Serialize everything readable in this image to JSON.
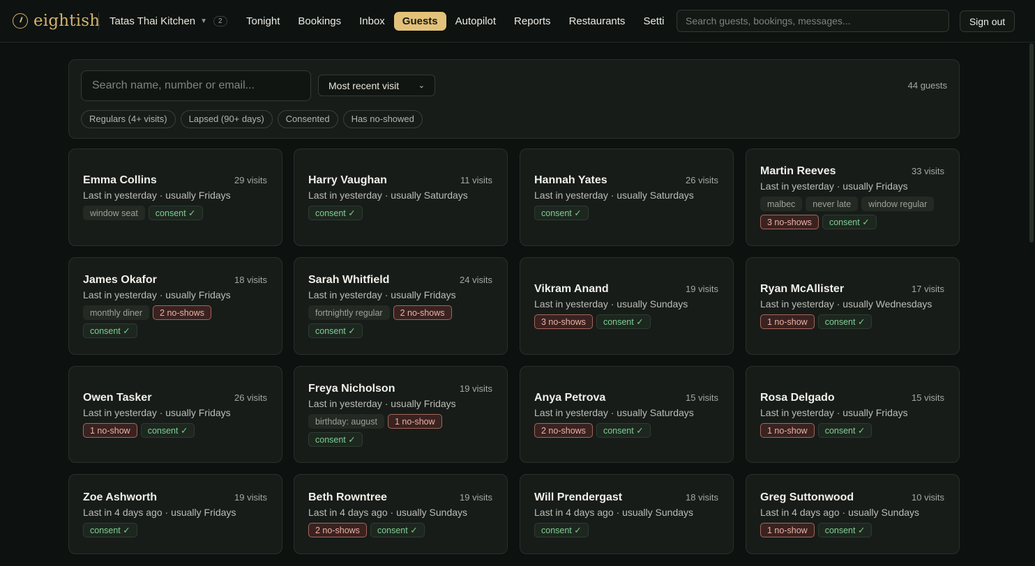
{
  "app": {
    "brand": "eightish",
    "restaurant": "Tatas Thai Kitchen",
    "restaurant_count": "2"
  },
  "nav": {
    "items": [
      "Tonight",
      "Bookings",
      "Inbox",
      "Guests",
      "Autopilot",
      "Reports",
      "Restaurants",
      "Setti"
    ],
    "active": "Guests"
  },
  "header": {
    "search_placeholder": "Search guests, bookings, messages...",
    "sign_out": "Sign out"
  },
  "filters": {
    "search_placeholder": "Search name, number or email...",
    "sort_value": "Most recent visit",
    "guest_count": "44 guests",
    "chips": [
      "Regulars (4+ visits)",
      "Lapsed (90+ days)",
      "Consented",
      "Has no-showed"
    ]
  },
  "colors": {
    "accent": "#e2c27a",
    "background": "#0d110f",
    "card": "#171c19",
    "consent": "#7fcf94",
    "no_show": "#eab1a5"
  },
  "guests": [
    {
      "name": "Emma Collins",
      "visits": "29 visits",
      "last_in": "Last in yesterday · usually Fridays",
      "tags": [
        {
          "text": "window seat",
          "kind": "note"
        },
        {
          "text": "consent ✓",
          "kind": "consent"
        }
      ]
    },
    {
      "name": "Harry Vaughan",
      "visits": "11 visits",
      "last_in": "Last in yesterday · usually Saturdays",
      "tags": [
        {
          "text": "consent ✓",
          "kind": "consent"
        }
      ]
    },
    {
      "name": "Hannah Yates",
      "visits": "26 visits",
      "last_in": "Last in yesterday · usually Saturdays",
      "tags": [
        {
          "text": "consent ✓",
          "kind": "consent"
        }
      ]
    },
    {
      "name": "Martin Reeves",
      "visits": "33 visits",
      "last_in": "Last in yesterday · usually Fridays",
      "tags": [
        {
          "text": "malbec",
          "kind": "note"
        },
        {
          "text": "never late",
          "kind": "note"
        },
        {
          "text": "window regular",
          "kind": "note"
        },
        {
          "text": "3 no-shows",
          "kind": "noshow"
        },
        {
          "text": "consent ✓",
          "kind": "consent"
        }
      ]
    },
    {
      "name": "James Okafor",
      "visits": "18 visits",
      "last_in": "Last in yesterday · usually Fridays",
      "tags": [
        {
          "text": "monthly diner",
          "kind": "note"
        },
        {
          "text": "2 no-shows",
          "kind": "noshow"
        },
        {
          "text": "consent ✓",
          "kind": "consent"
        }
      ]
    },
    {
      "name": "Sarah Whitfield",
      "visits": "24 visits",
      "last_in": "Last in yesterday · usually Fridays",
      "tags": [
        {
          "text": "fortnightly regular",
          "kind": "note"
        },
        {
          "text": "2 no-shows",
          "kind": "noshow"
        },
        {
          "text": "consent ✓",
          "kind": "consent"
        }
      ]
    },
    {
      "name": "Vikram Anand",
      "visits": "19 visits",
      "last_in": "Last in yesterday · usually Sundays",
      "tags": [
        {
          "text": "3 no-shows",
          "kind": "noshow"
        },
        {
          "text": "consent ✓",
          "kind": "consent"
        }
      ]
    },
    {
      "name": "Ryan McAllister",
      "visits": "17 visits",
      "last_in": "Last in yesterday · usually Wednesdays",
      "tags": [
        {
          "text": "1 no-show",
          "kind": "noshow"
        },
        {
          "text": "consent ✓",
          "kind": "consent"
        }
      ]
    },
    {
      "name": "Owen Tasker",
      "visits": "26 visits",
      "last_in": "Last in yesterday · usually Fridays",
      "tags": [
        {
          "text": "1 no-show",
          "kind": "noshow"
        },
        {
          "text": "consent ✓",
          "kind": "consent"
        }
      ]
    },
    {
      "name": "Freya Nicholson",
      "visits": "19 visits",
      "last_in": "Last in yesterday · usually Fridays",
      "tags": [
        {
          "text": "birthday: august",
          "kind": "note"
        },
        {
          "text": "1 no-show",
          "kind": "noshow"
        },
        {
          "text": "consent ✓",
          "kind": "consent"
        }
      ]
    },
    {
      "name": "Anya Petrova",
      "visits": "15 visits",
      "last_in": "Last in yesterday · usually Saturdays",
      "tags": [
        {
          "text": "2 no-shows",
          "kind": "noshow"
        },
        {
          "text": "consent ✓",
          "kind": "consent"
        }
      ]
    },
    {
      "name": "Rosa Delgado",
      "visits": "15 visits",
      "last_in": "Last in yesterday · usually Fridays",
      "tags": [
        {
          "text": "1 no-show",
          "kind": "noshow"
        },
        {
          "text": "consent ✓",
          "kind": "consent"
        }
      ]
    },
    {
      "name": "Zoe Ashworth",
      "visits": "19 visits",
      "last_in": "Last in 4 days ago · usually Fridays",
      "tags": [
        {
          "text": "consent ✓",
          "kind": "consent"
        }
      ]
    },
    {
      "name": "Beth Rowntree",
      "visits": "19 visits",
      "last_in": "Last in 4 days ago · usually Sundays",
      "tags": [
        {
          "text": "2 no-shows",
          "kind": "noshow"
        },
        {
          "text": "consent ✓",
          "kind": "consent"
        }
      ]
    },
    {
      "name": "Will Prendergast",
      "visits": "18 visits",
      "last_in": "Last in 4 days ago · usually Sundays",
      "tags": [
        {
          "text": "consent ✓",
          "kind": "consent"
        }
      ]
    },
    {
      "name": "Greg Suttonwood",
      "visits": "10 visits",
      "last_in": "Last in 4 days ago · usually Sundays",
      "tags": [
        {
          "text": "1 no-show",
          "kind": "noshow"
        },
        {
          "text": "consent ✓",
          "kind": "consent"
        }
      ]
    }
  ]
}
